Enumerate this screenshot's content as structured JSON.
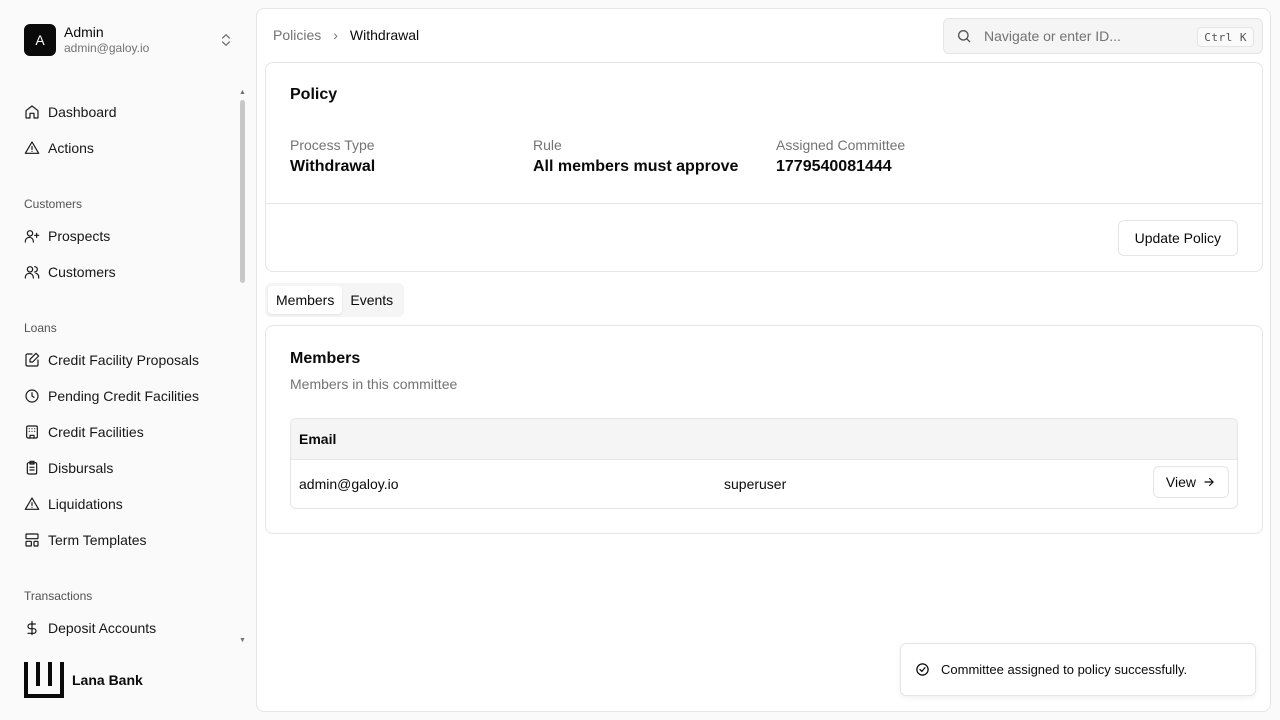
{
  "user": {
    "initial": "A",
    "name": "Admin",
    "email": "admin@galoy.io"
  },
  "nav": {
    "dashboard": "Dashboard",
    "actions": "Actions",
    "customers_group": "Customers",
    "prospects": "Prospects",
    "customers": "Customers",
    "loans_group": "Loans",
    "credit_facility_proposals": "Credit Facility Proposals",
    "pending_credit_facilities": "Pending Credit Facilities",
    "credit_facilities": "Credit Facilities",
    "disbursals": "Disbursals",
    "liquidations": "Liquidations",
    "term_templates": "Term Templates",
    "transactions_group": "Transactions",
    "deposit_accounts": "Deposit Accounts"
  },
  "brand": {
    "name": "Lana Bank"
  },
  "breadcrumb": {
    "parent": "Policies",
    "current": "Withdrawal"
  },
  "search": {
    "placeholder": "Navigate or enter ID...",
    "shortcut": "Ctrl K"
  },
  "policy": {
    "title": "Policy",
    "process_type_label": "Process Type",
    "process_type_value": "Withdrawal",
    "rule_label": "Rule",
    "rule_value": "All members must approve",
    "committee_label": "Assigned Committee",
    "committee_value": "1779540081444",
    "update_button": "Update Policy"
  },
  "tabs": {
    "members": "Members",
    "events": "Events",
    "active": "members"
  },
  "members": {
    "title": "Members",
    "subtitle": "Members in this committee",
    "column_email": "Email",
    "rows": [
      {
        "email": "admin@galoy.io",
        "role": "superuser",
        "action": "View"
      }
    ]
  },
  "toast": {
    "message": "Committee assigned to policy successfully."
  }
}
